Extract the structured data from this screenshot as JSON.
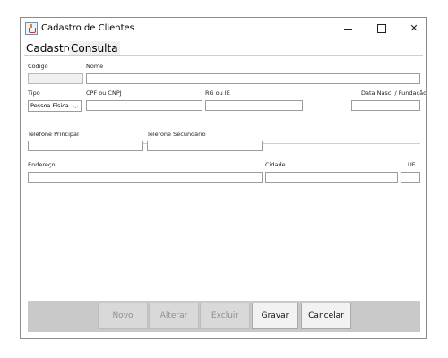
{
  "window": {
    "title": "Cadastro de Clientes",
    "minimize": "—",
    "close": "✕"
  },
  "tabs": {
    "cadastro": "Cadastro",
    "consulta": "Consulta"
  },
  "form": {
    "codigo_label": "Código",
    "nome_label": "Nome",
    "tipo_label": "Tipo",
    "tipo_value": "Pessoa Física",
    "cpf_label": "CPF ou CNPJ",
    "rg_label": "RG ou IE",
    "data_label": "Data Nasc. / Fundação",
    "tel_principal_label": "Telefone Principal",
    "tel_secundario_label": "Telefone Secundário",
    "endereco_label": "Endereço",
    "cidade_label": "Cidade",
    "uf_label": "UF"
  },
  "buttons": {
    "novo": "Novo",
    "alterar": "Alterar",
    "excluir": "Excluir",
    "gravar": "Gravar",
    "cancelar": "Cancelar"
  }
}
